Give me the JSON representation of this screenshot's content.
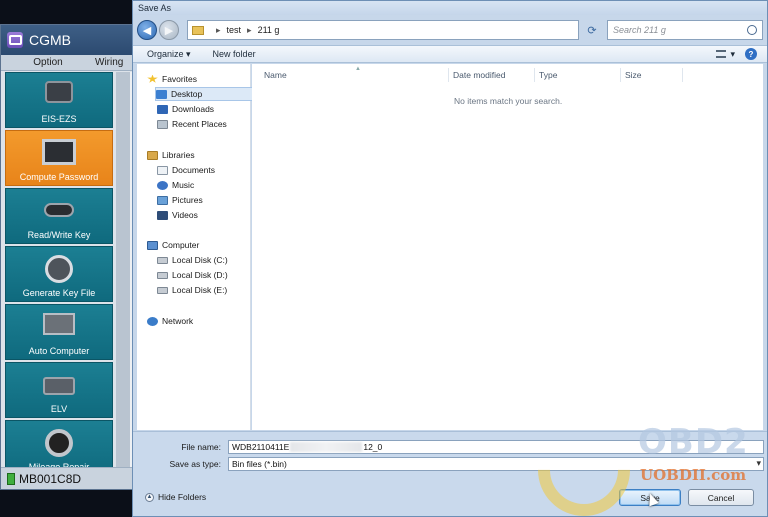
{
  "app": {
    "title": "CGMB",
    "menu": [
      "Option",
      "Wiring"
    ],
    "tiles": [
      {
        "label": "EIS-EZS",
        "icon": "ignition-switch-icon",
        "active": false
      },
      {
        "label": "Compute Password",
        "icon": "monitor-icon",
        "active": true
      },
      {
        "label": "Read/Write Key",
        "icon": "car-key-icon",
        "active": false
      },
      {
        "label": "Generate Key File",
        "icon": "key-file-icon",
        "active": false
      },
      {
        "label": "Auto Computer",
        "icon": "ecu-icon",
        "active": false
      },
      {
        "label": "ELV",
        "icon": "steering-lock-icon",
        "active": false
      },
      {
        "label": "Mileage Repair",
        "icon": "gauge-icon",
        "active": false
      }
    ],
    "status": "MB001C8D"
  },
  "dialog": {
    "title": "Save As",
    "breadcrumb": [
      "test",
      "211 g"
    ],
    "search_placeholder": "Search 211 g",
    "toolbar": {
      "organize": "Organize ▾",
      "new_folder": "New folder",
      "view": "▾"
    },
    "nav": {
      "favorites": {
        "header": "Favorites",
        "items": [
          "Desktop",
          "Downloads",
          "Recent Places"
        ],
        "selected": "Desktop"
      },
      "libraries": {
        "header": "Libraries",
        "items": [
          "Documents",
          "Music",
          "Pictures",
          "Videos"
        ]
      },
      "computer": {
        "header": "Computer",
        "items": [
          "Local Disk (C:)",
          "Local Disk (D:)",
          "Local Disk (E:)"
        ]
      },
      "network": {
        "header": "Network"
      }
    },
    "columns": [
      "Name",
      "Date modified",
      "Type",
      "Size"
    ],
    "empty_message": "No items match your search.",
    "file_name_label": "File name:",
    "file_name_value_start": "WDB2110411E",
    "file_name_value_end": "12_0",
    "save_as_type_label": "Save as type:",
    "save_as_type_value": "Bin files (*.bin)",
    "hide_folders": "Hide Folders",
    "save_button": "Save",
    "cancel_button": "Cancel"
  },
  "watermark": {
    "brand": "OBD2",
    "url": "UOBDII.com"
  }
}
